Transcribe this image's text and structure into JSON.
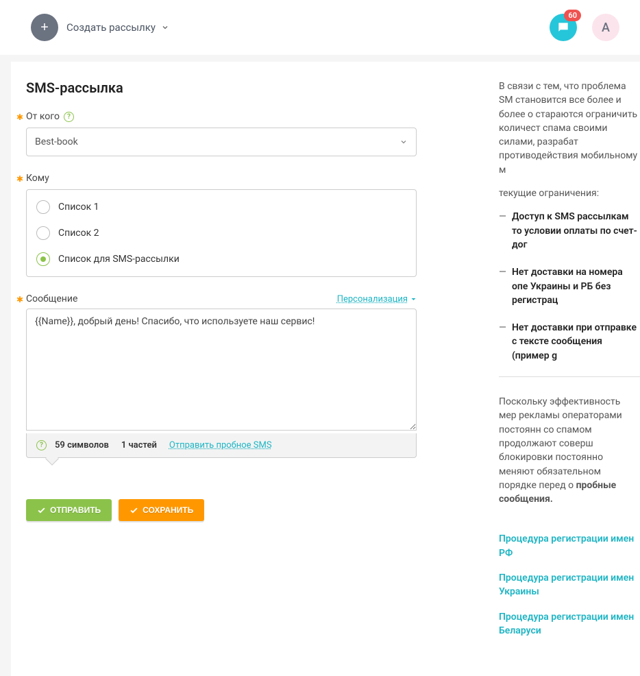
{
  "topbar": {
    "create_label": "Создать рассылку",
    "badge_count": "60",
    "avatar_letter": "A"
  },
  "page": {
    "title": "SMS-рассылка"
  },
  "from": {
    "label": "От кого",
    "selected": "Best-book"
  },
  "to": {
    "label": "Кому",
    "options": [
      {
        "label": "Список 1",
        "checked": false
      },
      {
        "label": "Список 2",
        "checked": false
      },
      {
        "label": "Список для SMS-рассылки",
        "checked": true
      }
    ]
  },
  "message": {
    "label": "Сообщение",
    "personalize": "Персонализация",
    "text": "{{Name}}, добрый день! Спасибо, что используете наш сервис!",
    "char_count": "59 символов",
    "parts": "1 частей",
    "try_link": "Отправить пробное SMS"
  },
  "actions": {
    "send": "ОТПРАВИТЬ",
    "save": "СОХРАНИТЬ"
  },
  "side": {
    "intro": "В связи с тем, что проблема SM становится все более и более о стараются ограничить количест спама своими силами, разрабат противодействия мобильному м",
    "current": "текущие ограничения:",
    "items": [
      "Доступ к SMS рассылкам то условии оплаты по счет-дог",
      "Нет доставки на номера опе Украины и РБ без регистрац",
      "Нет доставки при отправке с тексте сообщения (пример g"
    ],
    "mid": "Поскольку эффективность мер рекламы операторами постоянн со спамом продолжают соверш блокировки постоянно меняют обязательном порядке перед о",
    "mid_bold": "пробные сообщения.",
    "links": [
      "Процедура регистрации имен РФ",
      "Процедура регистрации имен Украины",
      "Процедура регистрации имен Беларуси"
    ]
  }
}
